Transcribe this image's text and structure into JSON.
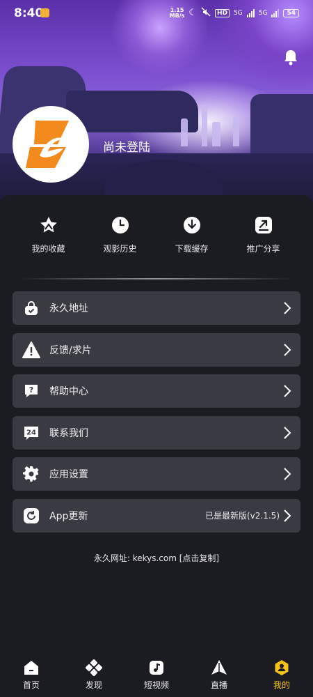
{
  "status_bar": {
    "time": "8:40",
    "net_speed_value": "1.15",
    "net_speed_unit": "MB/s",
    "hd": "HD",
    "signal1": "5G",
    "signal2": "5G",
    "battery": "54"
  },
  "profile": {
    "username": "尚未登陆"
  },
  "quick_actions": [
    {
      "label": "我的收藏",
      "icon": "star-icon"
    },
    {
      "label": "观影历史",
      "icon": "clock-icon"
    },
    {
      "label": "下载缓存",
      "icon": "download-icon"
    },
    {
      "label": "推广分享",
      "icon": "share-icon"
    }
  ],
  "menu": [
    {
      "label": "永久地址",
      "icon": "lock-bag-icon",
      "value": ""
    },
    {
      "label": "反馈/求片",
      "icon": "warning-icon",
      "value": ""
    },
    {
      "label": "帮助中心",
      "icon": "help-icon",
      "value": ""
    },
    {
      "label": "联系我们",
      "icon": "24h-icon",
      "value": ""
    },
    {
      "label": "应用设置",
      "icon": "gear-icon",
      "value": ""
    },
    {
      "label": "App更新",
      "icon": "refresh-icon",
      "value": "已是最新版(v2.1.5)"
    }
  ],
  "footer_note": "永久网址: kekys.com [点击复制]",
  "bottom_nav": [
    {
      "label": "首页",
      "icon": "home-icon",
      "active": false
    },
    {
      "label": "发现",
      "icon": "discover-icon",
      "active": false
    },
    {
      "label": "短视频",
      "icon": "music-note-icon",
      "active": false
    },
    {
      "label": "直播",
      "icon": "live-icon",
      "active": false
    },
    {
      "label": "我的",
      "icon": "user-icon",
      "active": true
    }
  ],
  "colors": {
    "background": "#1b1c22",
    "row_background": "#3a3a42",
    "accent_active": "#f4c21a",
    "logo_orange": "#f28a1e"
  }
}
